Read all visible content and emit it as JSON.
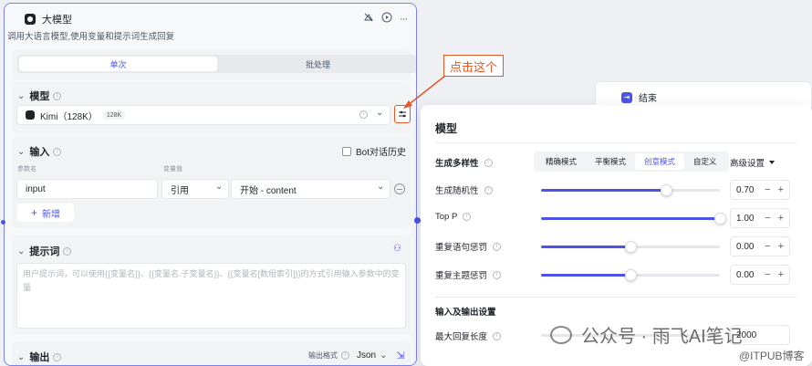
{
  "node": {
    "title": "大模型",
    "description": "调用大语言模型,使用变量和提示词生成回复",
    "tabs": [
      {
        "label": "单次",
        "active": true
      },
      {
        "label": "批处理",
        "active": false
      }
    ],
    "model_section": {
      "title": "模型",
      "model_name": "Kimi（128K）",
      "model_badge": "128K"
    },
    "input_section": {
      "title": "输入",
      "bot_history_label": "Bot对话历史",
      "param_name_header": "参数名",
      "var_value_header": "变量值",
      "param_value": "input",
      "ref_type": "引用",
      "ref_value": "开始 - content",
      "add_label": "新增"
    },
    "prompt_section": {
      "title": "提示词",
      "placeholder": "用户提示词，可以使用{{变量名}}、{{变量名.子变量名}}、{{变量名[数组索引]}}的方式引用输入参数中的变量"
    },
    "output_section": {
      "title": "输出",
      "format_label": "输出格式",
      "format_value": "Json"
    }
  },
  "callout": {
    "text": "点击这个"
  },
  "end_node": {
    "title": "结束"
  },
  "popup": {
    "title": "模型",
    "diversity_label": "生成多样性",
    "diversity_tabs": [
      {
        "label": "精确模式",
        "active": false
      },
      {
        "label": "平衡模式",
        "active": false
      },
      {
        "label": "创意模式",
        "active": true
      },
      {
        "label": "自定义",
        "active": false
      }
    ],
    "advanced_label": "高级设置",
    "params": [
      {
        "label": "生成随机性",
        "value": "0.70",
        "fraction": 0.7
      },
      {
        "label": "Top P",
        "value": "1.00",
        "fraction": 1.0
      },
      {
        "label": "重复语句惩罚",
        "value": "0.00",
        "fraction": 0.5
      },
      {
        "label": "重复主题惩罚",
        "value": "0.00",
        "fraction": 0.5
      }
    ],
    "io_section_title": "输入及输出设置",
    "max_len_label": "最大回复长度",
    "max_len_value": "2000"
  },
  "watermark": {
    "text": "公众号 · 雨飞AI笔记",
    "sub": "@ITPUB博客"
  },
  "colors": {
    "accent": "#4d53e8",
    "callout": "#e5582a",
    "border_selected": "#7b83ea"
  }
}
